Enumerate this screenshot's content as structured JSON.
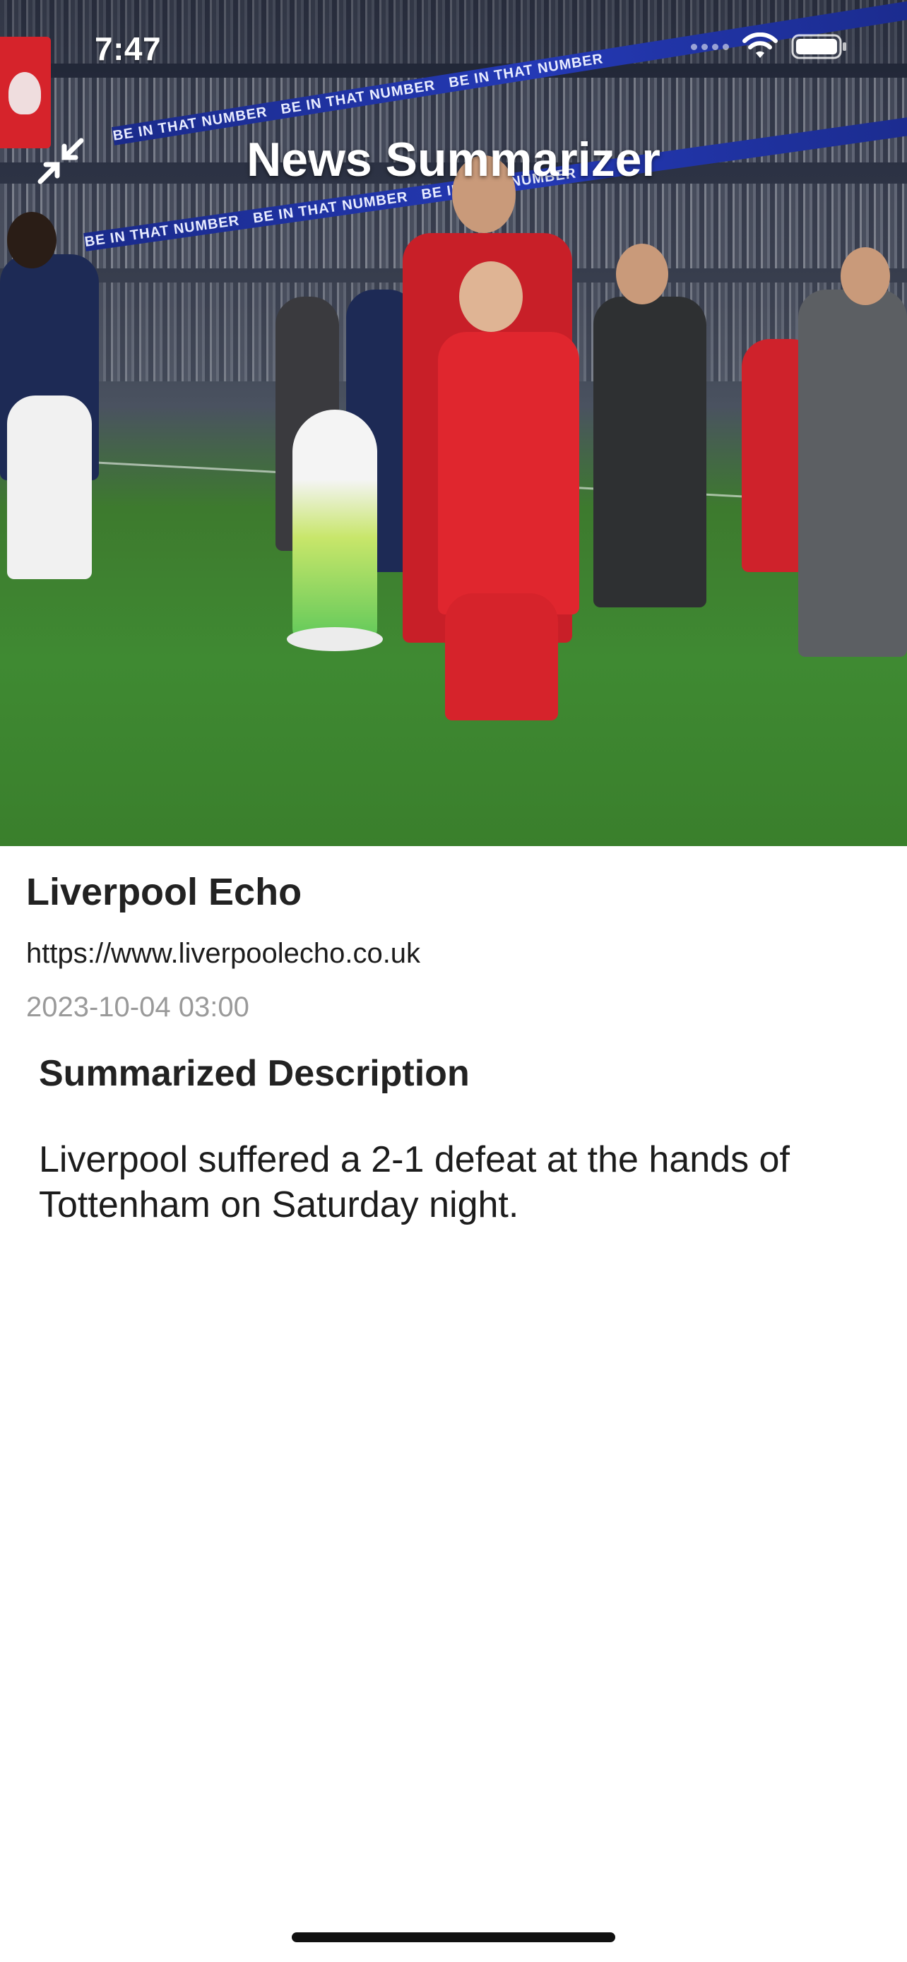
{
  "status_bar": {
    "time": "7:47"
  },
  "nav": {
    "title": "News Summarizer",
    "collapse_icon": "collapse-arrows-icon"
  },
  "hero_image": {
    "description_icon": "news-photo",
    "ad_board_text": "BE IN THAT NUMBER",
    "colors": {
      "pitch": "#3f8a32",
      "kit_red": "#d6232b",
      "kit_navy": "#1d2a55"
    }
  },
  "article": {
    "source_name": "Liverpool Echo",
    "source_url": "https://www.liverpoolecho.co.uk",
    "published": "2023-10-04 03:00",
    "summary_heading": "Summarized Description",
    "summary": "Liverpool suffered a 2-1 defeat at the hands of Tottenham on Saturday night."
  },
  "colors": {
    "background": "#ffffff",
    "primary_text": "#222222",
    "secondary_text": "#9a9a9a"
  }
}
